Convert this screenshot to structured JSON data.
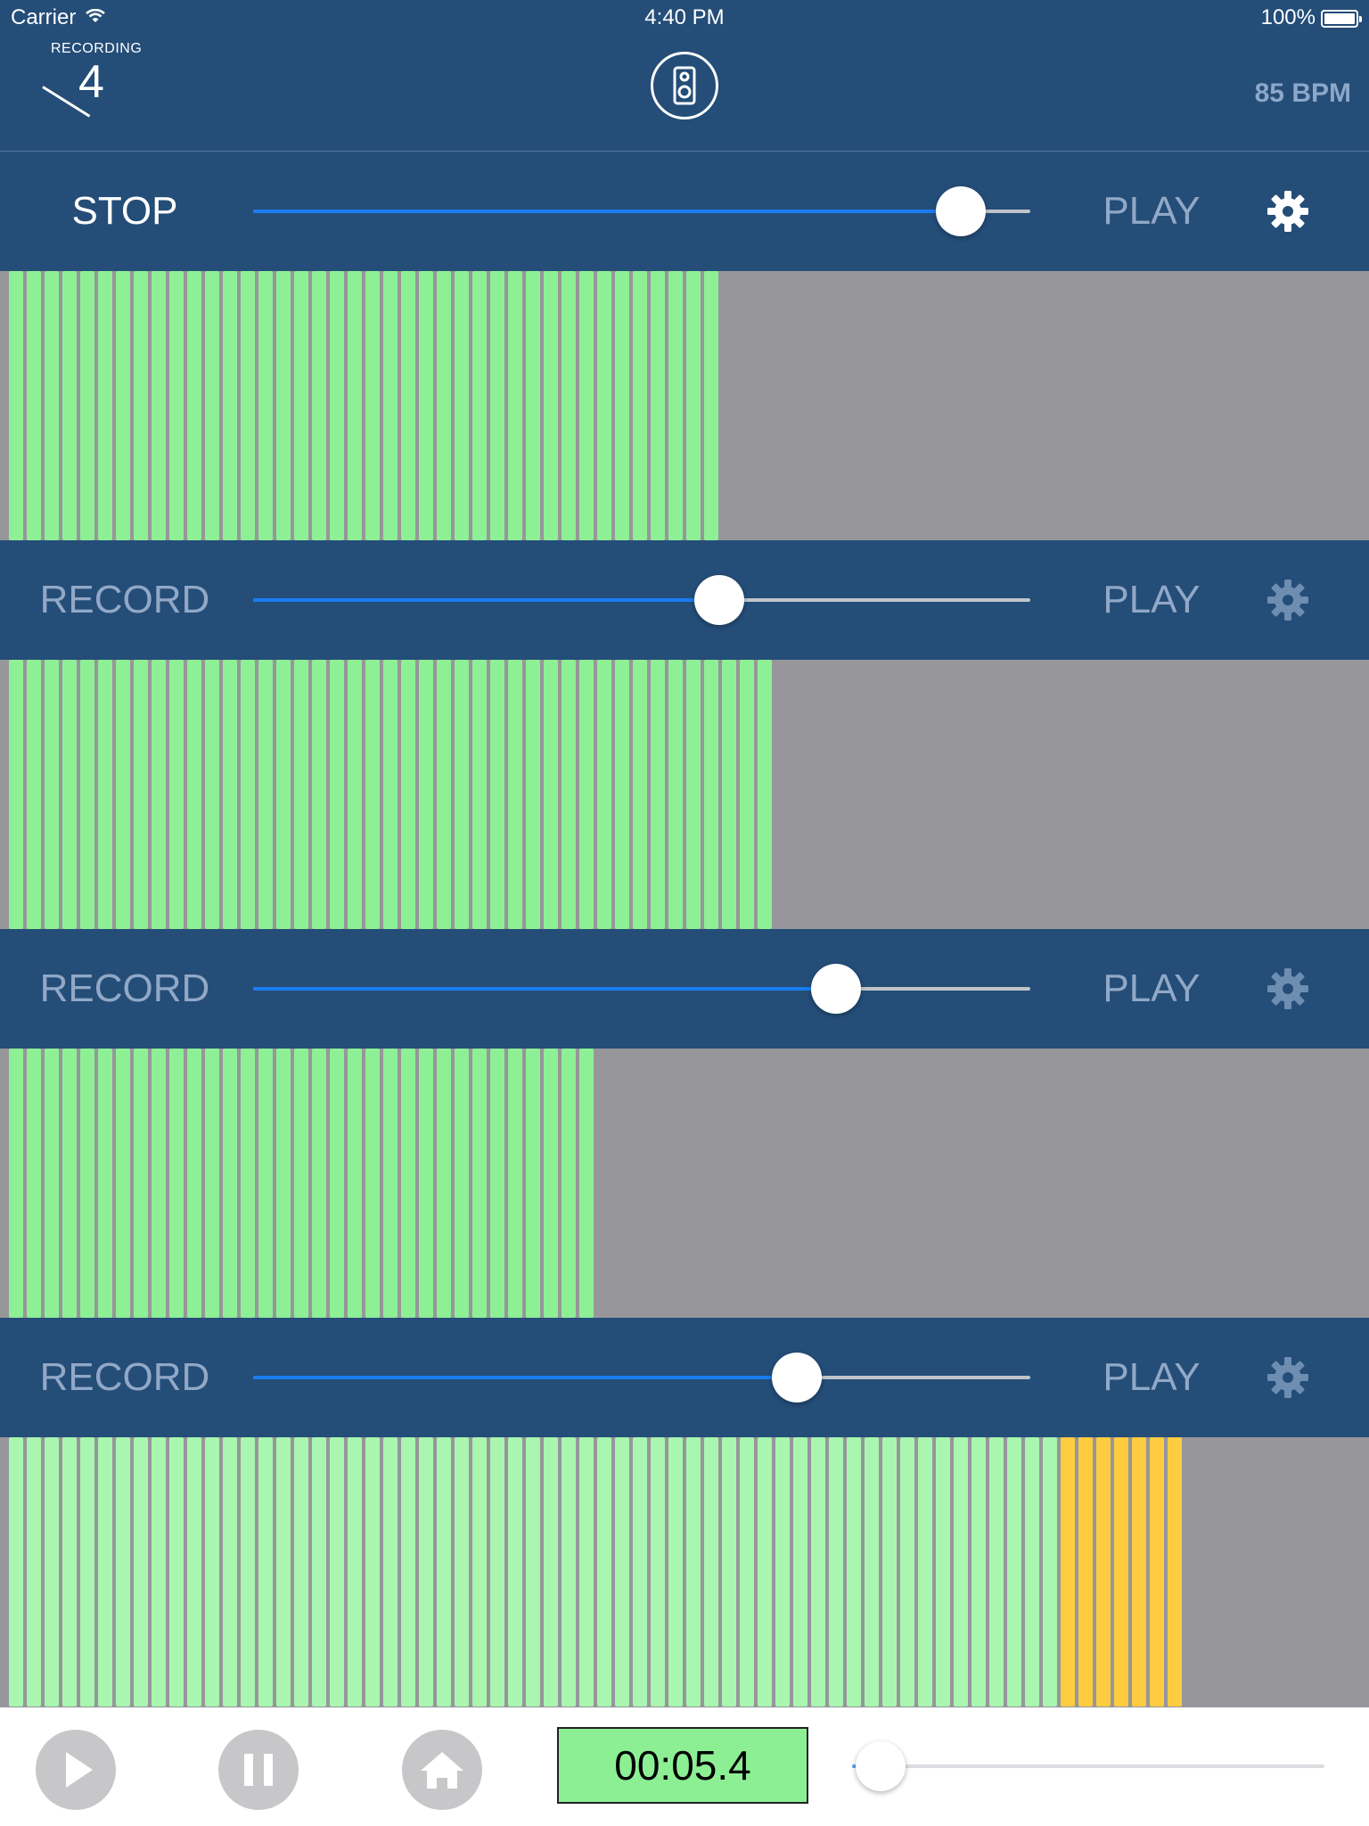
{
  "status_bar": {
    "carrier": "Carrier",
    "time": "4:40 PM",
    "battery": "100%"
  },
  "header": {
    "recording_label": "RECORDING",
    "recording_count": "4",
    "bpm": "85 BPM",
    "center_icon": "speaker-icon"
  },
  "tracks": [
    {
      "left_label": "STOP",
      "left_active": true,
      "play_label": "PLAY",
      "slider_value": 0.91,
      "gear_active": true,
      "bars": 40,
      "yellow_bars": 0
    },
    {
      "left_label": "RECORD",
      "left_active": false,
      "play_label": "PLAY",
      "slider_value": 0.6,
      "gear_active": false,
      "bars": 43,
      "yellow_bars": 0
    },
    {
      "left_label": "RECORD",
      "left_active": false,
      "play_label": "PLAY",
      "slider_value": 0.75,
      "gear_active": false,
      "bars": 33,
      "yellow_bars": 0
    },
    {
      "left_label": "RECORD",
      "left_active": false,
      "play_label": "PLAY",
      "slider_value": 0.7,
      "gear_active": false,
      "bars": 66,
      "yellow_bars": 7
    }
  ],
  "toolbar": {
    "play_icon": "play-icon",
    "pause_icon": "pause-icon",
    "home_icon": "home-icon",
    "timer": "00:05.4",
    "scrub_value": 0.06
  },
  "colors": {
    "header_bg": "#244d78",
    "wave_bg": "#97969b",
    "bar_green": "#8ef095",
    "bar_light_green": "#a9f6b0",
    "bar_yellow": "#fdcc41",
    "slider_blue": "#1a7cf0",
    "timer_bg": "#8cef94"
  }
}
